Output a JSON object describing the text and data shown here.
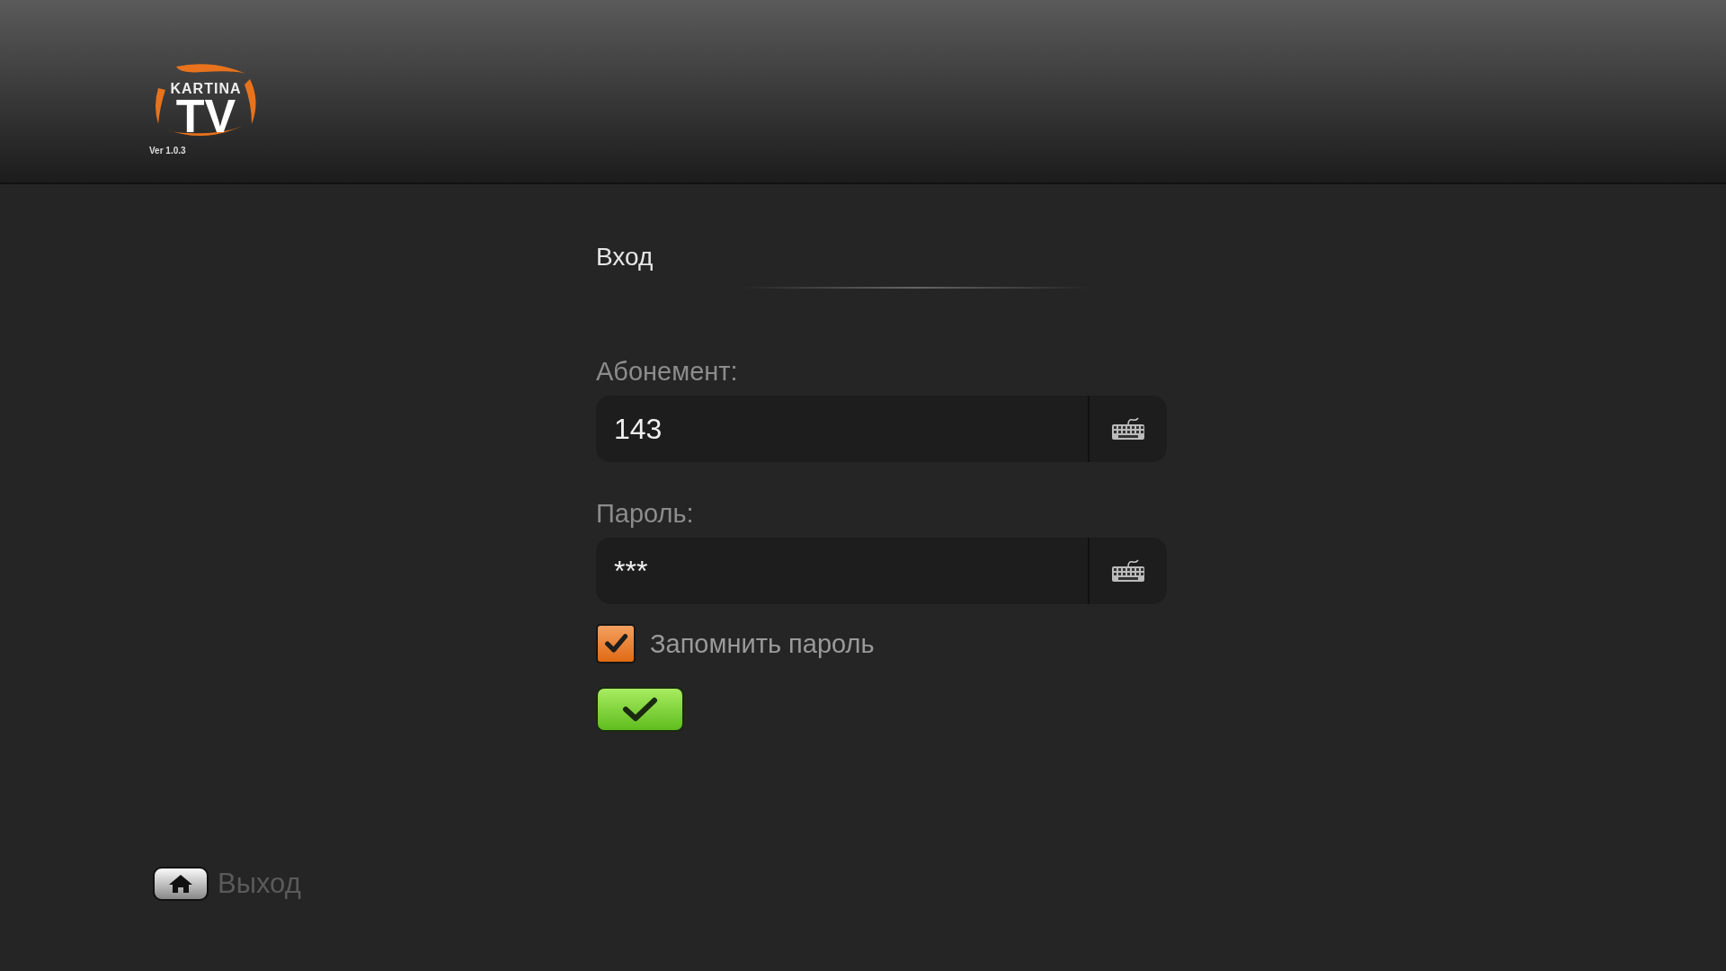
{
  "header": {
    "logo": {
      "brand": "KARTINA",
      "mark": "TV"
    },
    "version": "Ver 1.0.3"
  },
  "form": {
    "title": "Вход",
    "fields": [
      {
        "label": "Абонемент:",
        "value": "143"
      },
      {
        "label": "Пароль:",
        "value": "***"
      }
    ],
    "remember": {
      "label": "Запомнить пароль",
      "checked": true
    }
  },
  "footer": {
    "exit_label": "Выход"
  }
}
